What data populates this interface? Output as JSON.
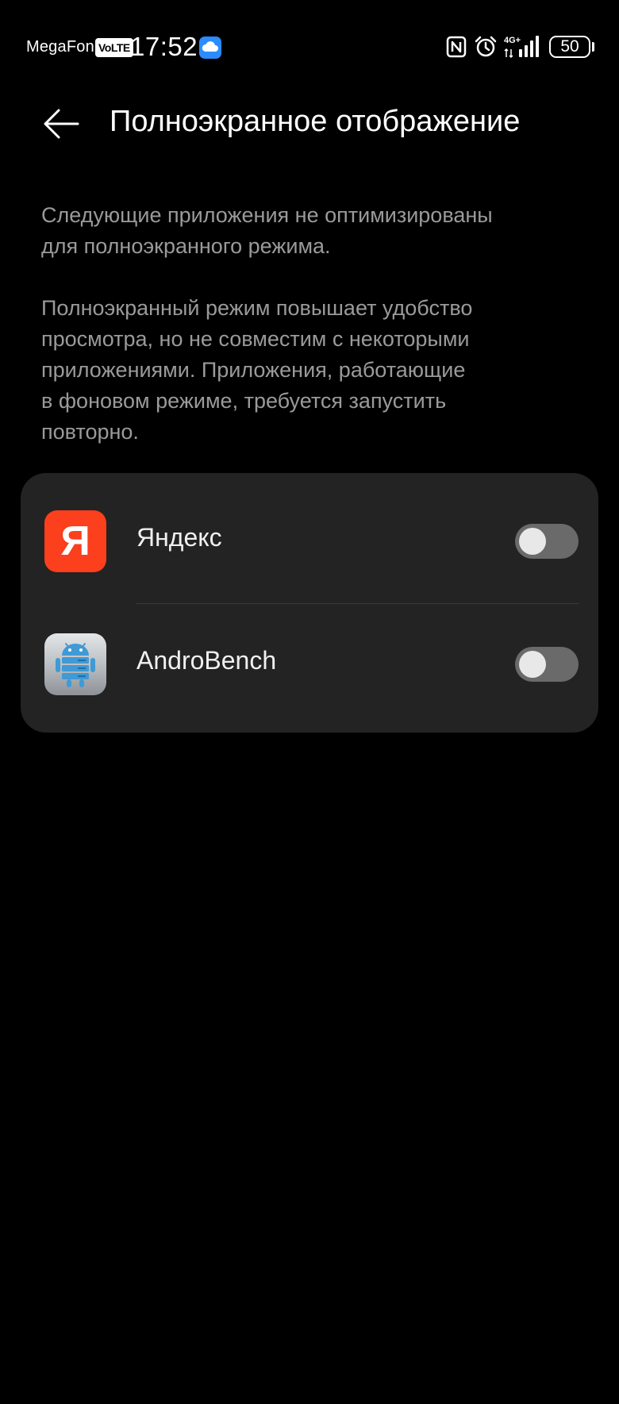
{
  "status_bar": {
    "carrier": "MegaFon",
    "volte": "VoLTE",
    "time": "17:52",
    "network": "4G+",
    "battery": "50",
    "icons": [
      "cloud-icon",
      "nfc-icon",
      "alarm-icon",
      "signal-icon",
      "battery-icon"
    ]
  },
  "header": {
    "title": "Полноэкранное отображение",
    "back_icon": "arrow-left-icon"
  },
  "description": {
    "paragraph_1": "Следующие приложения не оптимизированы\nдля полноэкранного режима.",
    "paragraph_2": "Полноэкранный режим повышает удобство\nпросмотра, но не совместим с некоторыми\nприложениями. Приложения, работающие\nв фоновом режиме, требуется запустить\nповторно."
  },
  "apps": [
    {
      "name": "Яндекс",
      "icon": "yandex-app-icon",
      "icon_letter": "Я",
      "icon_color": "#fc3f1d",
      "enabled": false
    },
    {
      "name": "AndroBench",
      "icon": "androbench-app-icon",
      "enabled": false
    }
  ],
  "colors": {
    "background": "#000000",
    "card": "#232323",
    "secondary_text": "#9a9a9a",
    "toggle_off_track": "#6a6a6a",
    "toggle_knob": "#e8e8e8"
  }
}
